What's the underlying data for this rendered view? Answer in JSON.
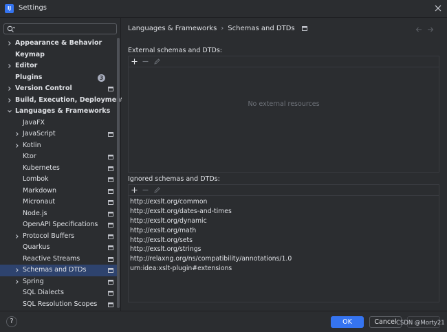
{
  "window": {
    "title": "Settings",
    "logo_text": "IJ",
    "close_icon": "close-icon"
  },
  "search": {
    "value": "",
    "placeholder": ""
  },
  "sidebar": {
    "items": [
      {
        "label": "Appearance & Behavior",
        "chevron": "right",
        "bold": true,
        "level": 0
      },
      {
        "label": "Keymap",
        "chevron": "none",
        "bold": true,
        "level": 0
      },
      {
        "label": "Editor",
        "chevron": "right",
        "bold": true,
        "level": 0
      },
      {
        "label": "Plugins",
        "chevron": "none",
        "bold": true,
        "level": 0,
        "badge": "3"
      },
      {
        "label": "Version Control",
        "chevron": "right",
        "bold": true,
        "level": 0,
        "settings_icon": true
      },
      {
        "label": "Build, Execution, Deployment",
        "chevron": "right",
        "bold": true,
        "level": 0
      },
      {
        "label": "Languages & Frameworks",
        "chevron": "down",
        "bold": true,
        "level": 0
      },
      {
        "label": "JavaFX",
        "chevron": "none",
        "bold": false,
        "level": 1
      },
      {
        "label": "JavaScript",
        "chevron": "right",
        "bold": false,
        "level": 1,
        "settings_icon": true
      },
      {
        "label": "Kotlin",
        "chevron": "right",
        "bold": false,
        "level": 1
      },
      {
        "label": "Ktor",
        "chevron": "none",
        "bold": false,
        "level": 1,
        "settings_icon": true
      },
      {
        "label": "Kubernetes",
        "chevron": "none",
        "bold": false,
        "level": 1,
        "settings_icon": true
      },
      {
        "label": "Lombok",
        "chevron": "none",
        "bold": false,
        "level": 1,
        "settings_icon": true
      },
      {
        "label": "Markdown",
        "chevron": "none",
        "bold": false,
        "level": 1,
        "settings_icon": true
      },
      {
        "label": "Micronaut",
        "chevron": "none",
        "bold": false,
        "level": 1,
        "settings_icon": true
      },
      {
        "label": "Node.js",
        "chevron": "none",
        "bold": false,
        "level": 1,
        "settings_icon": true
      },
      {
        "label": "OpenAPI Specifications",
        "chevron": "none",
        "bold": false,
        "level": 1,
        "settings_icon": true
      },
      {
        "label": "Protocol Buffers",
        "chevron": "right",
        "bold": false,
        "level": 1,
        "settings_icon": true
      },
      {
        "label": "Quarkus",
        "chevron": "none",
        "bold": false,
        "level": 1,
        "settings_icon": true
      },
      {
        "label": "Reactive Streams",
        "chevron": "none",
        "bold": false,
        "level": 1,
        "settings_icon": true
      },
      {
        "label": "Schemas and DTDs",
        "chevron": "right",
        "bold": false,
        "level": 1,
        "settings_icon": true,
        "selected": true
      },
      {
        "label": "Spring",
        "chevron": "right",
        "bold": false,
        "level": 1,
        "settings_icon": true
      },
      {
        "label": "SQL Dialects",
        "chevron": "none",
        "bold": false,
        "level": 1,
        "settings_icon": true
      },
      {
        "label": "SQL Resolution Scopes",
        "chevron": "none",
        "bold": false,
        "level": 1,
        "settings_icon": true
      }
    ]
  },
  "main": {
    "breadcrumb": {
      "parent": "Languages & Frameworks",
      "separator": "›",
      "current": "Schemas and DTDs"
    },
    "external": {
      "label": "External schemas and DTDs:",
      "empty_text": "No external resources"
    },
    "ignored": {
      "label": "Ignored schemas and DTDs:",
      "items": [
        "http://exslt.org/common",
        "http://exslt.org/dates-and-times",
        "http://exslt.org/dynamic",
        "http://exslt.org/math",
        "http://exslt.org/sets",
        "http://exslt.org/strings",
        "http://relaxng.org/ns/compatibility/annotations/1.0",
        "urn:idea:xslt-plugin#extensions"
      ]
    }
  },
  "footer": {
    "help_label": "?",
    "ok_label": "OK",
    "cancel_label": "Cancel",
    "apply_label": "",
    "watermark": "CSDN @Morty21"
  },
  "colors": {
    "background": "#2b2d30",
    "accent": "#3574f0",
    "selection": "#2e436e",
    "text": "#dfe1e5",
    "muted_text": "#6f737a"
  }
}
